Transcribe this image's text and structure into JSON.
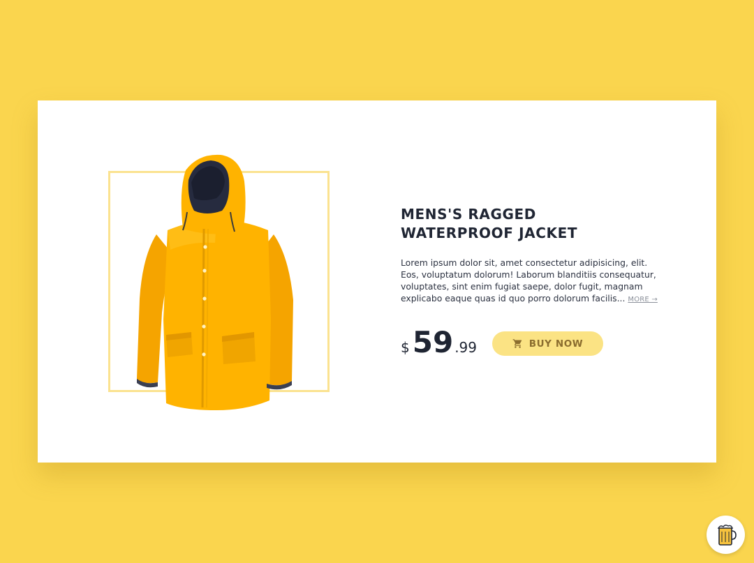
{
  "product": {
    "title_line1": "MENS'S RAGGED",
    "title_line2": "WATERPROOF JACKET",
    "description": "Lorem ipsum dolor sit, amet consectetur adipisicing, elit. Eos, voluptatum dolorum! Laborum blanditiis consequatur, voluptates, sint enim fugiat saepe, dolor fugit, magnam explicabo eaque quas id quo porro dolorum facilis...",
    "more_label": "MORE →",
    "image_icon": "yellow-rain-jacket-image"
  },
  "price": {
    "currency": "$",
    "whole": "59",
    "cents": ".99"
  },
  "buy_button": {
    "label": "BUY NOW",
    "icon": "cart-icon"
  },
  "badge": {
    "icon": "buy-me-a-beer-icon"
  },
  "colors": {
    "background": "#fad54e",
    "card": "#ffffff",
    "frame_border": "#fbe28f",
    "button": "#fbe384",
    "button_text": "#8b6d2e",
    "heading": "#1f2533",
    "jacket": "#ffb300"
  }
}
